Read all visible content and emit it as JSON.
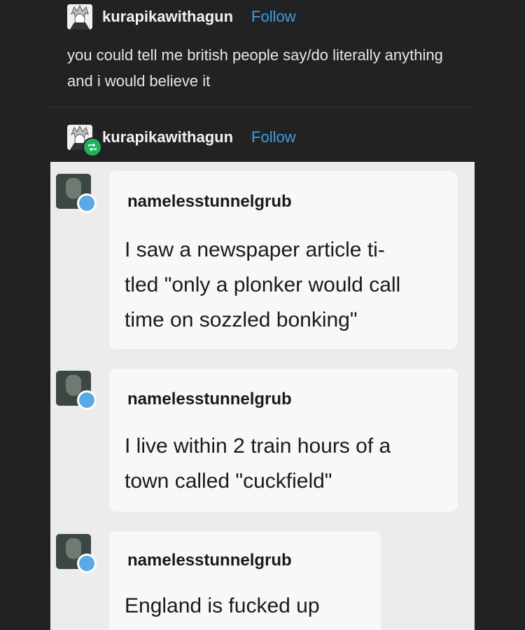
{
  "post": {
    "username": "kurapikawithagun",
    "follow_label": "Follow",
    "text": "you could tell me british people say/do literally anything and i would believe it"
  },
  "reblog": {
    "username": "kurapikawithagun",
    "follow_label": "Follow"
  },
  "messages": [
    {
      "sender": "namelesstunnelgrub",
      "text": "I saw a newspaper article ti-tled \"only a plonker would call time on sozzled bonking\"",
      "lines": [
        "I saw a newspaper article ti-",
        "tled \"only a plonker would call",
        "time on sozzled bonking\""
      ]
    },
    {
      "sender": "namelesstunnelgrub",
      "text": "I live within 2 train hours of a town called \"cuckfield\"",
      "lines": [
        "I live within 2 train hours of a",
        "town called \"cuckfield\""
      ]
    },
    {
      "sender": "namelesstunnelgrub",
      "text": "England is fucked up",
      "lines": [
        "England is fucked up"
      ]
    }
  ],
  "colors": {
    "background": "#222222",
    "follow": "#3d9de0",
    "reblog_badge": "#1fb25a",
    "chat_background": "#ececec",
    "bubble": "#f7f8fa",
    "status_dot": "#5aa9e6"
  }
}
